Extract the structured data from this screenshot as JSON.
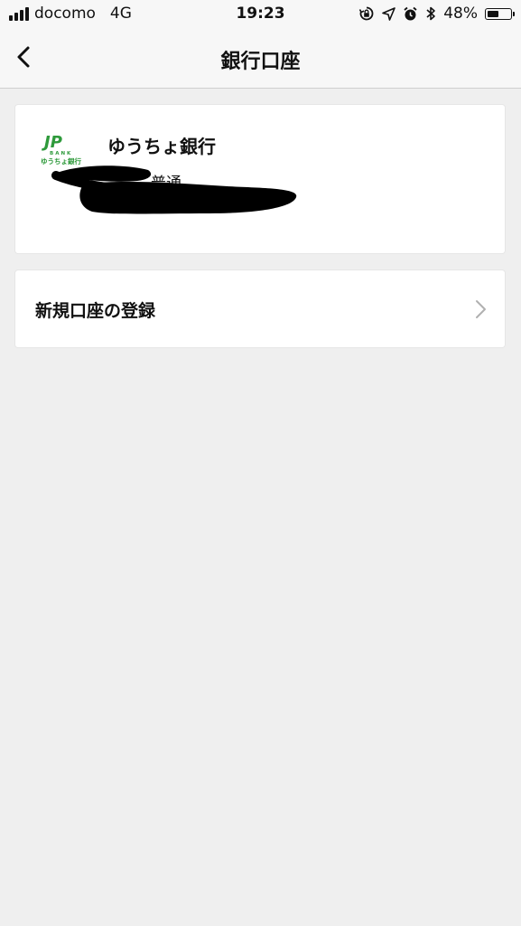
{
  "status_bar": {
    "carrier": "docomo",
    "network": "4G",
    "time": "19:23",
    "battery_percent": "48%",
    "battery_level": 0.48,
    "icons": [
      "rotation-lock-icon",
      "location-icon",
      "alarm-icon",
      "bluetooth-icon"
    ]
  },
  "nav": {
    "title": "銀行口座",
    "back_icon": "chevron-left-icon"
  },
  "bank_account": {
    "logo_text": "JP",
    "logo_sub": "BANK",
    "logo_caption": "ゆうちょ銀行",
    "bank_name": "ゆうちょ銀行",
    "account_type": "普通"
  },
  "register": {
    "label": "新規口座の登録",
    "icon": "chevron-right-icon"
  },
  "colors": {
    "background": "#efefef",
    "logo_green": "#2e9a3b",
    "chevron_gray": "#b0b0b0"
  }
}
